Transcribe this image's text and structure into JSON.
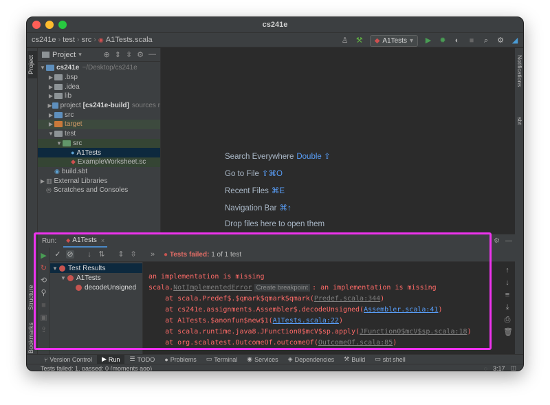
{
  "window": {
    "title": "cs241e"
  },
  "breadcrumb": [
    "cs241e",
    "test",
    "src",
    "A1Tests.scala"
  ],
  "navbar": {
    "run_config": "A1Tests"
  },
  "left_tabs": {
    "project": "Project",
    "structure": "Structure",
    "bookmarks": "Bookmarks"
  },
  "right_tabs": {
    "notifications": "Notifications",
    "sbt": "sbt"
  },
  "project": {
    "header": "Project",
    "root_name": "cs241e",
    "root_path": "~/Desktop/cs241e",
    "items": {
      "bsp": ".bsp",
      "idea": ".idea",
      "lib": "lib",
      "project_prefix": "project",
      "project_bold": "[cs241e-build]",
      "project_suffix": "sources r",
      "src": "src",
      "target": "target",
      "test": "test",
      "test_src": "src",
      "a1tests": "A1Tests",
      "worksheet": "ExampleWorksheet.sc",
      "build": "build.sbt",
      "external": "External Libraries",
      "scratches": "Scratches and Consoles"
    }
  },
  "editor_hints": [
    {
      "label": "Search Everywhere",
      "key": "Double ⇧"
    },
    {
      "label": "Go to File",
      "key": "⇧⌘O"
    },
    {
      "label": "Recent Files",
      "key": "⌘E"
    },
    {
      "label": "Navigation Bar",
      "key": "⌘↑"
    },
    {
      "label": "Drop files here to open them",
      "key": ""
    }
  ],
  "run": {
    "label": "Run:",
    "tab": "A1Tests",
    "status_bold": "Tests failed:",
    "status_rest": "1 of 1 test",
    "tree": {
      "root": "Test Results",
      "suite": "A1Tests",
      "test": "decodeUnsigned"
    },
    "console": {
      "line1": "an implementation is missing",
      "l2_prefix": "scala.",
      "l2_class": "NotImplementedError",
      "l2_bp": "Create breakpoint",
      "l2_msg": ": an implementation is missing",
      "l3_text": "    at scala.Predef$.$qmark$qmark$qmark(",
      "l3_link": "Predef.scala:344",
      "l4_text": "    at cs241e.assignments.Assembler$.decodeUnsigned(",
      "l4_link": "Assembler.scala:41",
      "l5_text": "    at A1Tests.$anonfun$new$1(",
      "l5_link": "A1Tests.scala:22",
      "l6_text": "    at scala.runtime.java8.JFunction0$mcV$sp.apply(",
      "l6_link": "JFunction0$mcV$sp.scala:18",
      "l7_text": "    at org.scalatest.OutcomeOf.outcomeOf(",
      "l7_link": "OutcomeOf.scala:85",
      "close": ")"
    }
  },
  "bottom_tools": [
    "Version Control",
    "Run",
    "TODO",
    "Problems",
    "Terminal",
    "Services",
    "Dependencies",
    "Build",
    "sbt shell"
  ],
  "statusbar": {
    "message": "Tests failed: 1, passed: 0 (moments ago)",
    "position": "3:17"
  },
  "colors": {
    "highlight": "#ee33ee",
    "fail": "#c75450",
    "link": "#589df6"
  }
}
